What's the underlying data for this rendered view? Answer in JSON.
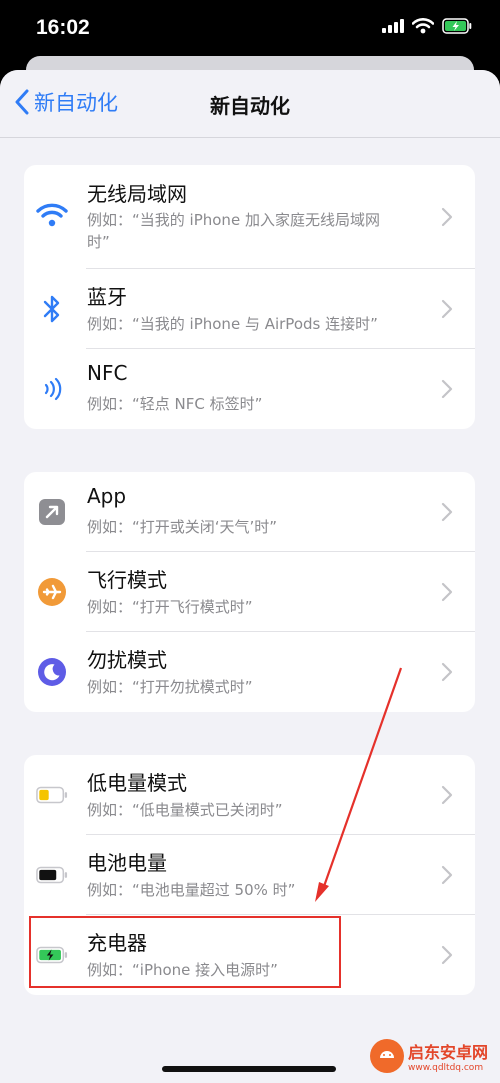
{
  "status": {
    "time": "16:02"
  },
  "nav": {
    "back_label": "新自动化",
    "title": "新自动化"
  },
  "groups": [
    {
      "rows": [
        {
          "title": "无线局域网",
          "subtitle": "例如：“当我的 iPhone 加入家庭无线局域网时”",
          "icon": "wifi-icon"
        },
        {
          "title": "蓝牙",
          "subtitle": "例如：“当我的 iPhone 与 AirPods 连接时”",
          "icon": "bluetooth-icon"
        },
        {
          "title": "NFC",
          "subtitle": "例如：“轻点 NFC 标签时”",
          "icon": "nfc-icon"
        }
      ]
    },
    {
      "rows": [
        {
          "title": "App",
          "subtitle": "例如：“打开或关闭‘天气’时”",
          "icon": "app-icon"
        },
        {
          "title": "飞行模式",
          "subtitle": "例如：“打开飞行模式时”",
          "icon": "airplane-icon"
        },
        {
          "title": "勿扰模式",
          "subtitle": "例如：“打开勿扰模式时”",
          "icon": "moon-icon"
        }
      ]
    },
    {
      "rows": [
        {
          "title": "低电量模式",
          "subtitle": "例如：“低电量模式已关闭时”",
          "icon": "battery-low-icon"
        },
        {
          "title": "电池电量",
          "subtitle": "例如：“电池电量超过 50% 时”",
          "icon": "battery-icon"
        },
        {
          "title": "充电器",
          "subtitle": "例如：“iPhone 接入电源时”",
          "icon": "charger-icon"
        }
      ]
    }
  ],
  "watermark": {
    "line1": "启东安卓网",
    "line2": "www.qdltdq.com"
  },
  "colors": {
    "accent": "#2f7cf6",
    "annotation": "#e5312b",
    "airplane": "#f19a38",
    "moon": "#5e5ce6",
    "low_battery": "#f5c400",
    "charging": "#34c759"
  }
}
